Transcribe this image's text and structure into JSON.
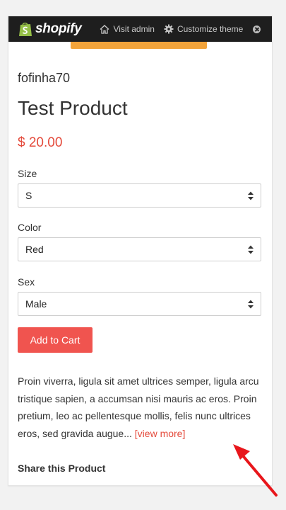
{
  "admin_bar": {
    "logo_text": "shopify",
    "visit_admin_label": "Visit admin",
    "customize_theme_label": "Customize theme"
  },
  "product": {
    "vendor": "fofinha70",
    "title": "Test Product",
    "price": "$ 20.00",
    "options": [
      {
        "label": "Size",
        "value": "S"
      },
      {
        "label": "Color",
        "value": "Red"
      },
      {
        "label": "Sex",
        "value": "Male"
      }
    ],
    "add_to_cart_label": "Add to Cart",
    "description": "Proin viverra, ligula sit amet ultrices semper, ligula arcu tristique sapien, a accumsan nisi mauris ac eros. Proin pretium, leo ac pellentesque mollis, felis nunc ultrices eros, sed gravida augue... ",
    "view_more_label": "[view more]",
    "share_heading": "Share this Product"
  },
  "colors": {
    "accent_red": "#e44a3b",
    "button_red": "#f0544f",
    "admin_bar_bg": "#1e1e1e",
    "logo_green": "#95bf47",
    "annotation_arrow": "#e8161b"
  },
  "icons": [
    "shopify-bag-icon",
    "home-icon",
    "gear-icon",
    "close-icon",
    "select-chevron-icon",
    "annotation-arrow"
  ]
}
